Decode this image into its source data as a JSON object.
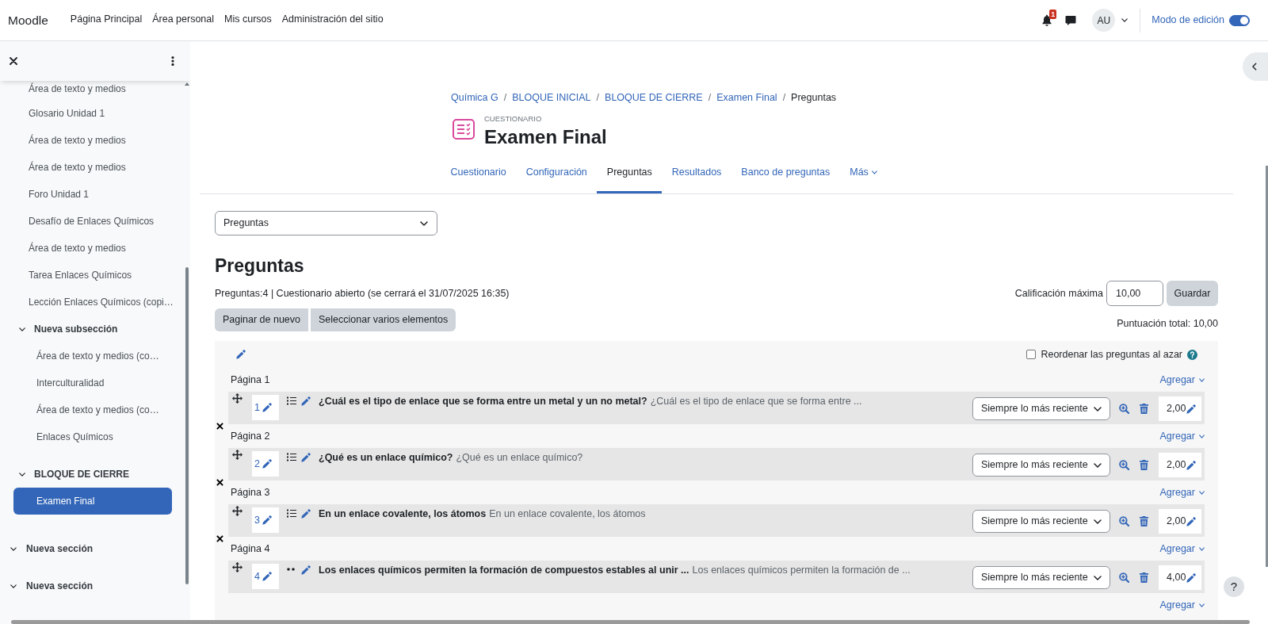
{
  "navbar": {
    "brand": "Moodle",
    "links": [
      {
        "label": "Página Principal",
        "selected": false
      },
      {
        "label": "Área personal",
        "selected": false
      },
      {
        "label": "Mis cursos",
        "selected": false
      },
      {
        "label": "Administración del sitio",
        "selected": false
      }
    ],
    "notification_count": "1",
    "avatar": "AU",
    "edit_mode": {
      "label": "Modo de edición",
      "on": true
    }
  },
  "course_index": {
    "sections": [
      {
        "children": [
          {
            "kind": "activity",
            "label": "Área de texto y medios",
            "selected": false
          },
          {
            "kind": "activity",
            "label": "Glosario Unidad 1",
            "selected": false
          },
          {
            "kind": "activity",
            "label": "Área de texto y medios",
            "selected": false
          },
          {
            "kind": "activity",
            "label": "Área de texto y medios",
            "selected": false
          },
          {
            "kind": "activity",
            "label": "Foro Unidad 1",
            "selected": false
          },
          {
            "kind": "activity",
            "label": "Desafío de Enlaces Químicos",
            "selected": false
          },
          {
            "kind": "activity",
            "label": "Área de texto y medios",
            "selected": false
          },
          {
            "kind": "activity",
            "label": "Tarea Enlaces Químicos",
            "selected": false
          },
          {
            "kind": "activity",
            "label": "Lección Enlaces Químicos (copi…",
            "selected": false
          },
          {
            "kind": "subsection",
            "label": "Nueva subsección",
            "expanded": true,
            "children": [
              {
                "kind": "activity",
                "label": "Área de texto y medios (co…",
                "selected": false
              },
              {
                "kind": "activity",
                "label": "Interculturalidad",
                "selected": false
              },
              {
                "kind": "activity",
                "label": "Área de texto y medios (co…",
                "selected": false
              },
              {
                "kind": "activity",
                "label": "Enlaces Químicos",
                "selected": false
              }
            ]
          },
          {
            "kind": "subsection",
            "label": "BLOQUE DE CIERRE",
            "expanded": true,
            "children": [
              {
                "kind": "activity",
                "label": "Examen Final",
                "selected": true
              }
            ]
          }
        ]
      },
      {
        "label": "Nueva sección",
        "expanded": true
      },
      {
        "label": "Nueva sección",
        "expanded": true
      }
    ]
  },
  "breadcrumb": [
    {
      "label": "Química G",
      "current": false
    },
    {
      "label": "BLOQUE INICIAL",
      "current": false,
      "separator": "/"
    },
    {
      "label": "BLOQUE DE CIERRE",
      "current": false,
      "separator": "/"
    },
    {
      "label": "Examen Final",
      "current": false,
      "separator": "/"
    },
    {
      "label": "Preguntas",
      "current": true,
      "separator": "/"
    }
  ],
  "activity_header": {
    "type_label": "CUESTIONARIO",
    "title": "Examen Final"
  },
  "tabs": [
    {
      "label": "Cuestionario",
      "selected": false,
      "menu": false
    },
    {
      "label": "Configuración",
      "selected": false,
      "menu": false
    },
    {
      "label": "Preguntas",
      "selected": true,
      "menu": false
    },
    {
      "label": "Resultados",
      "selected": false,
      "menu": false
    },
    {
      "label": "Banco de preguntas",
      "selected": false,
      "menu": false
    },
    {
      "label": "Más",
      "selected": false,
      "menu": true
    }
  ],
  "jump_menu": {
    "value": "Preguntas"
  },
  "heading": "Preguntas",
  "summary": "Preguntas:4 | Cuestionario abierto (se cerrará el 31/07/2025 16:35)",
  "max_grade": {
    "label": "Calificación máxima",
    "value": "10,00",
    "button": "Guardar"
  },
  "actions": [
    "Paginar de nuevo",
    "Seleccionar varios elementos"
  ],
  "total": "Puntuación total: 10,00",
  "shuffle": {
    "label": "Reordenar las preguntas al azar",
    "checked": false
  },
  "pages": [
    {
      "label": "Página 1",
      "add": "Agregar",
      "remove_break": false,
      "questions": [
        {
          "number": "1",
          "kind": "multichoice",
          "name": "¿Cuál es el tipo de enlace que se forma entre un metal y un no metal?",
          "text": "¿Cuál es el tipo de enlace que se forma entre ...",
          "behaviour": "Siempre lo más reciente",
          "mark": "2,00"
        }
      ]
    },
    {
      "label": "Página 2",
      "add": "Agregar",
      "remove_break": true,
      "questions": [
        {
          "number": "2",
          "kind": "multichoice",
          "name": "¿Qué es un enlace químico?",
          "text": "¿Qué es un enlace químico?",
          "behaviour": "Siempre lo más reciente",
          "mark": "2,00"
        }
      ]
    },
    {
      "label": "Página 3",
      "add": "Agregar",
      "remove_break": true,
      "questions": [
        {
          "number": "3",
          "kind": "multichoice",
          "name": "En un enlace covalente, los átomos",
          "text": "En un enlace covalente, los átomos",
          "behaviour": "Siempre lo más reciente",
          "mark": "2,00"
        }
      ]
    },
    {
      "label": "Página 4",
      "add": "Agregar",
      "remove_break": true,
      "questions": [
        {
          "number": "4",
          "kind": "truefalse",
          "name": "Los enlaces químicos permiten la formación de compuestos estables al unir ...",
          "text": "Los enlaces químicos permiten la formación de ...",
          "behaviour": "Siempre lo más reciente",
          "mark": "4,00"
        }
      ]
    }
  ],
  "end_add": "Agregar",
  "help_button": "?"
}
